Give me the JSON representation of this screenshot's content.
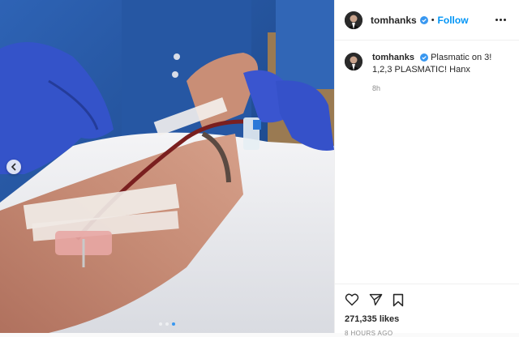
{
  "post": {
    "username": "tomhanks",
    "follow_label": "Follow",
    "separator": "•",
    "caption": "Plasmatic on 3! 1,2,3 PLASMATIC! Hanx",
    "relative_time": "8h",
    "likes": "271,335 likes",
    "posted_ago": "8 HOURS AGO"
  },
  "carousel": {
    "total": 3,
    "active_index": 2
  },
  "icons": {
    "verified": "verified-badge-icon",
    "more": "more-options-icon",
    "like": "heart-icon",
    "share": "paper-plane-icon",
    "save": "bookmark-icon",
    "prev": "chevron-left-icon"
  },
  "colors": {
    "follow": "#0095f6",
    "verified": "#3897f0",
    "muted": "#8e8e8e",
    "text": "#262626"
  }
}
